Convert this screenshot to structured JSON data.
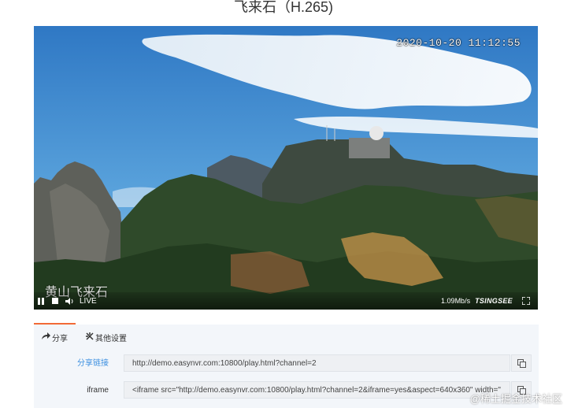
{
  "page": {
    "title": "飞来石（H.265)"
  },
  "player": {
    "osd_timestamp": "2020-10-20 11:12:55",
    "osd_location": "黄山飞来石",
    "live_label": "LIVE",
    "bitrate": "1.09Mb/s",
    "brand": "TSINGSEE",
    "icons": [
      "pause-icon",
      "stop-icon",
      "volume-icon",
      "fullscreen-icon"
    ]
  },
  "tabs": [
    {
      "label": "分享",
      "icon": "share-icon",
      "active": true
    },
    {
      "label": "其他设置",
      "icon": "settings-icon",
      "active": false
    }
  ],
  "share": {
    "link_label": "分享链接",
    "link_value": "http://demo.easynvr.com:10800/play.html?channel=2",
    "iframe_label": "iframe",
    "iframe_value": "<iframe src=\"http://demo.easynvr.com:10800/play.html?channel=2&iframe=yes&aspect=640x360\" width=\""
  },
  "watermark": "@稀土掘金技术社区",
  "colors": {
    "accent": "#f26a36",
    "link": "#3b8fe0",
    "panel_bg": "#f3f6fa"
  }
}
